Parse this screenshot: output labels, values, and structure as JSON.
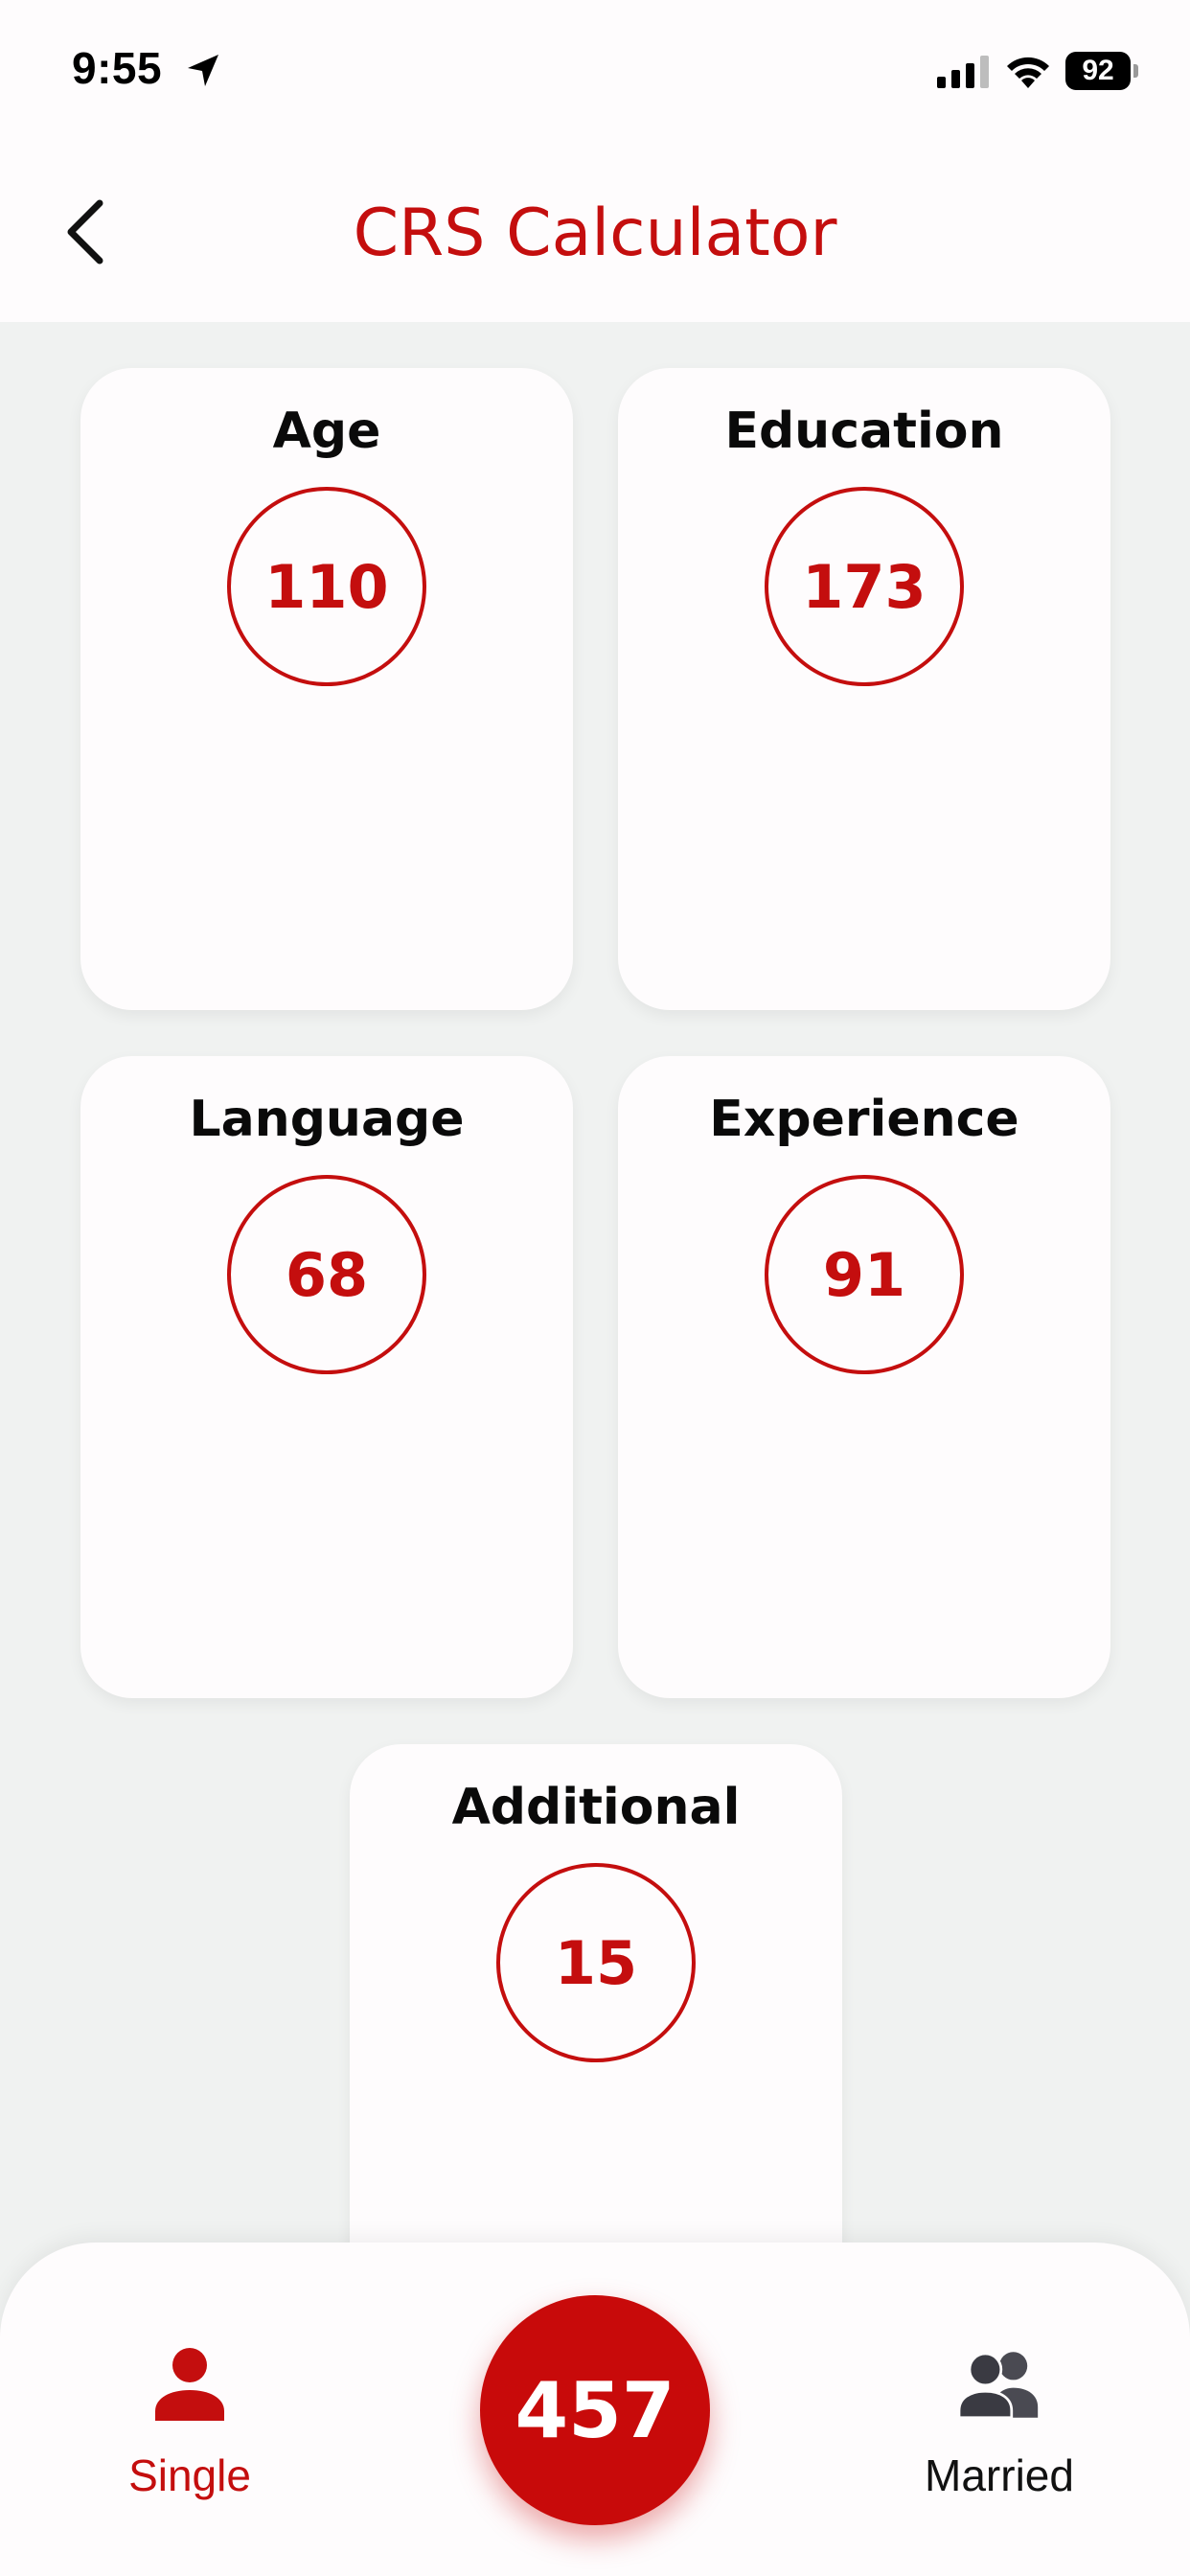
{
  "status_bar": {
    "time": "9:55",
    "battery": "92"
  },
  "header": {
    "title": "CRS Calculator"
  },
  "cards": [
    {
      "title": "Age",
      "score": "110"
    },
    {
      "title": "Education",
      "score": "173"
    },
    {
      "title": "Language",
      "score": "68"
    },
    {
      "title": "Experience",
      "score": "91"
    },
    {
      "title": "Additional",
      "score": "15"
    }
  ],
  "bottom_bar": {
    "total": "457",
    "tabs": [
      {
        "label": "Single",
        "icon": "person-icon",
        "active": true
      },
      {
        "label": "Married",
        "icon": "people-icon",
        "active": false
      }
    ]
  },
  "colors": {
    "accent": "#c40e0e",
    "background": "#f0f2f1",
    "surface": "#fefcfd"
  }
}
